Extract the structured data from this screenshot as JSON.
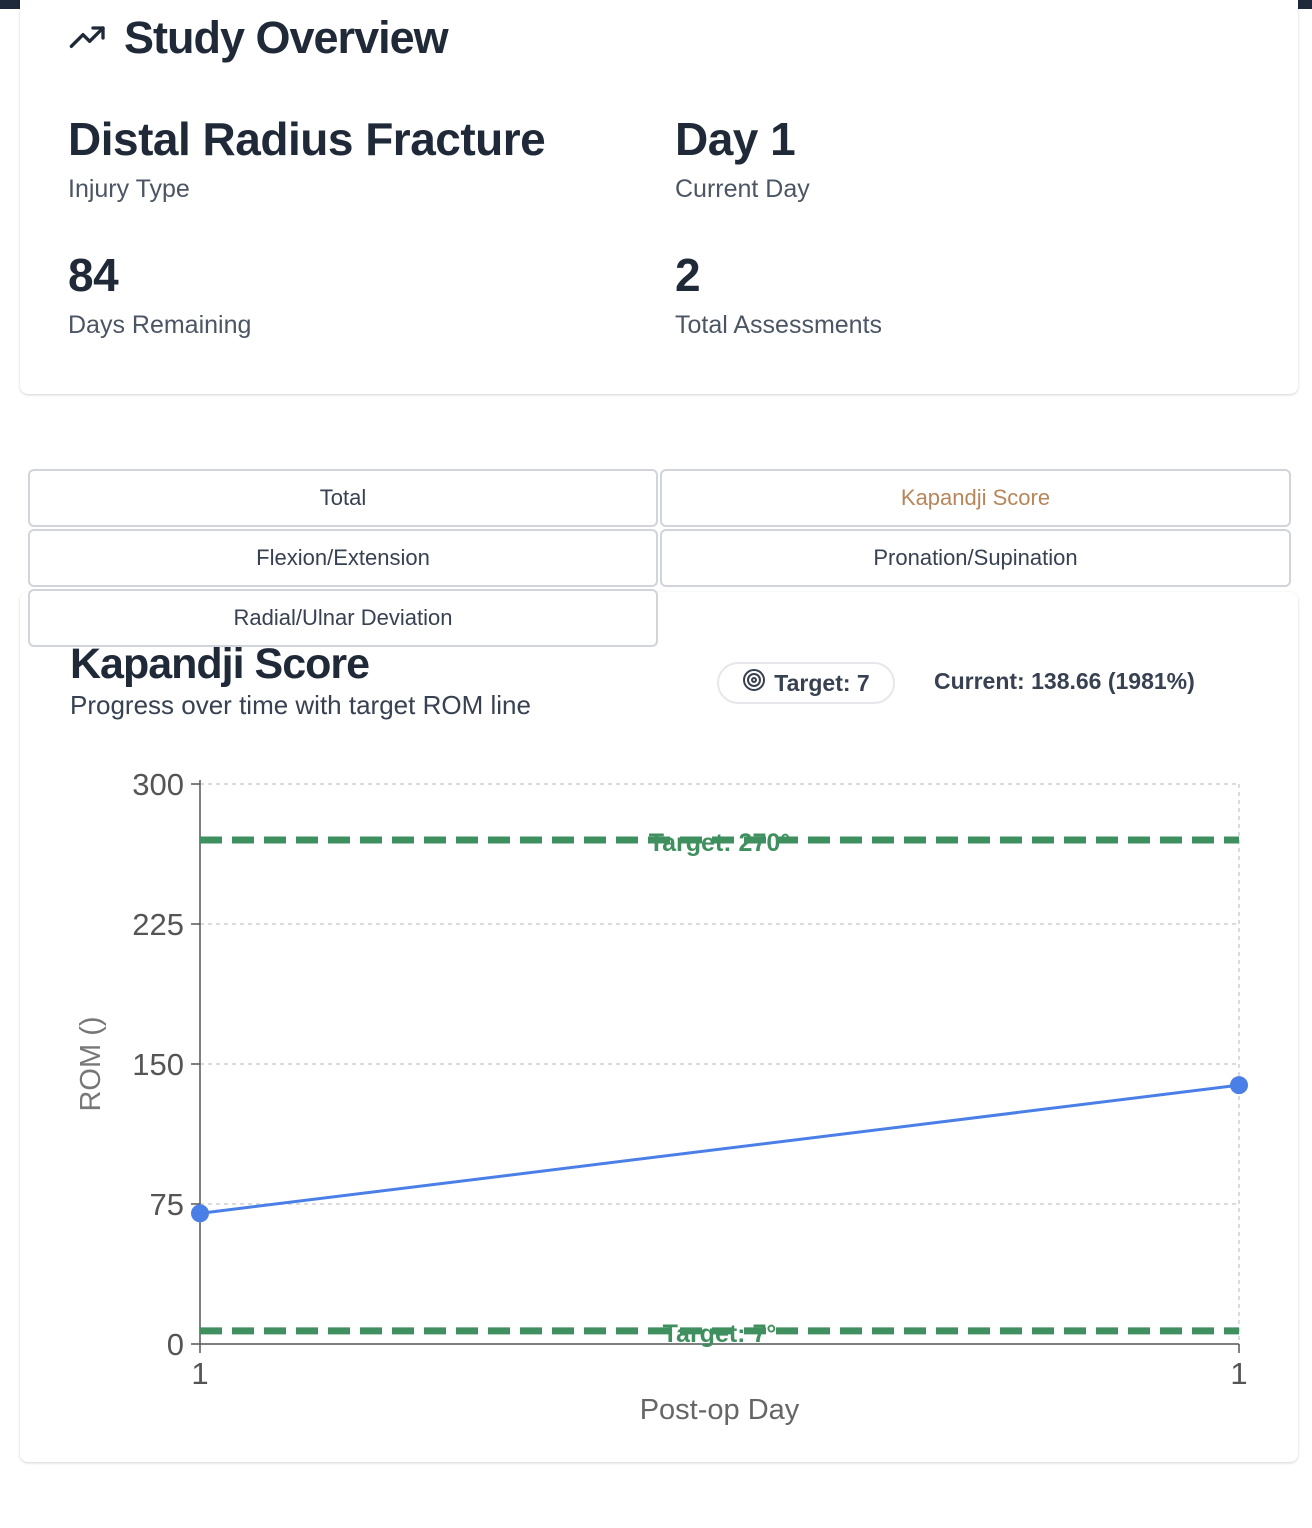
{
  "overview": {
    "title": "Study Overview",
    "icon": "trending-up-icon",
    "stats": [
      {
        "value": "Distal Radius Fracture",
        "label": "Injury Type"
      },
      {
        "value": "Day 1",
        "label": "Current Day"
      },
      {
        "value": "84",
        "label": "Days Remaining"
      },
      {
        "value": "2",
        "label": "Total Assessments"
      }
    ]
  },
  "tabs": [
    {
      "label": "Total",
      "active": false
    },
    {
      "label": "Kapandji Score",
      "active": true
    },
    {
      "label": "Flexion/Extension",
      "active": false
    },
    {
      "label": "Pronation/Supination",
      "active": false
    },
    {
      "label": "Radial/Ulnar Deviation",
      "active": false
    }
  ],
  "chart_panel": {
    "title": "Kapandji Score",
    "subtitle": "Progress over time with target ROM line",
    "target_badge": "Target: 7",
    "target_icon": "target-icon",
    "current": "Current: 138.66 (1981%)"
  },
  "colors": {
    "accent_tab": "#b8865a",
    "line": "#4a7fe8",
    "target_line": "#3f8f5f",
    "topbar": "#1e293b"
  },
  "chart_data": {
    "type": "line",
    "xlabel": "Post-op Day",
    "ylabel": "ROM ()",
    "ylim": [
      0,
      300
    ],
    "yticks": [
      0,
      75,
      150,
      225,
      300
    ],
    "xticks": [
      "1",
      "1"
    ],
    "grid": true,
    "series": [
      {
        "values": [
          70,
          138.66
        ]
      }
    ],
    "target_lines": [
      {
        "value": 270,
        "label": "Target: 270°"
      },
      {
        "value": 7,
        "label": "Target: 7°"
      }
    ]
  }
}
